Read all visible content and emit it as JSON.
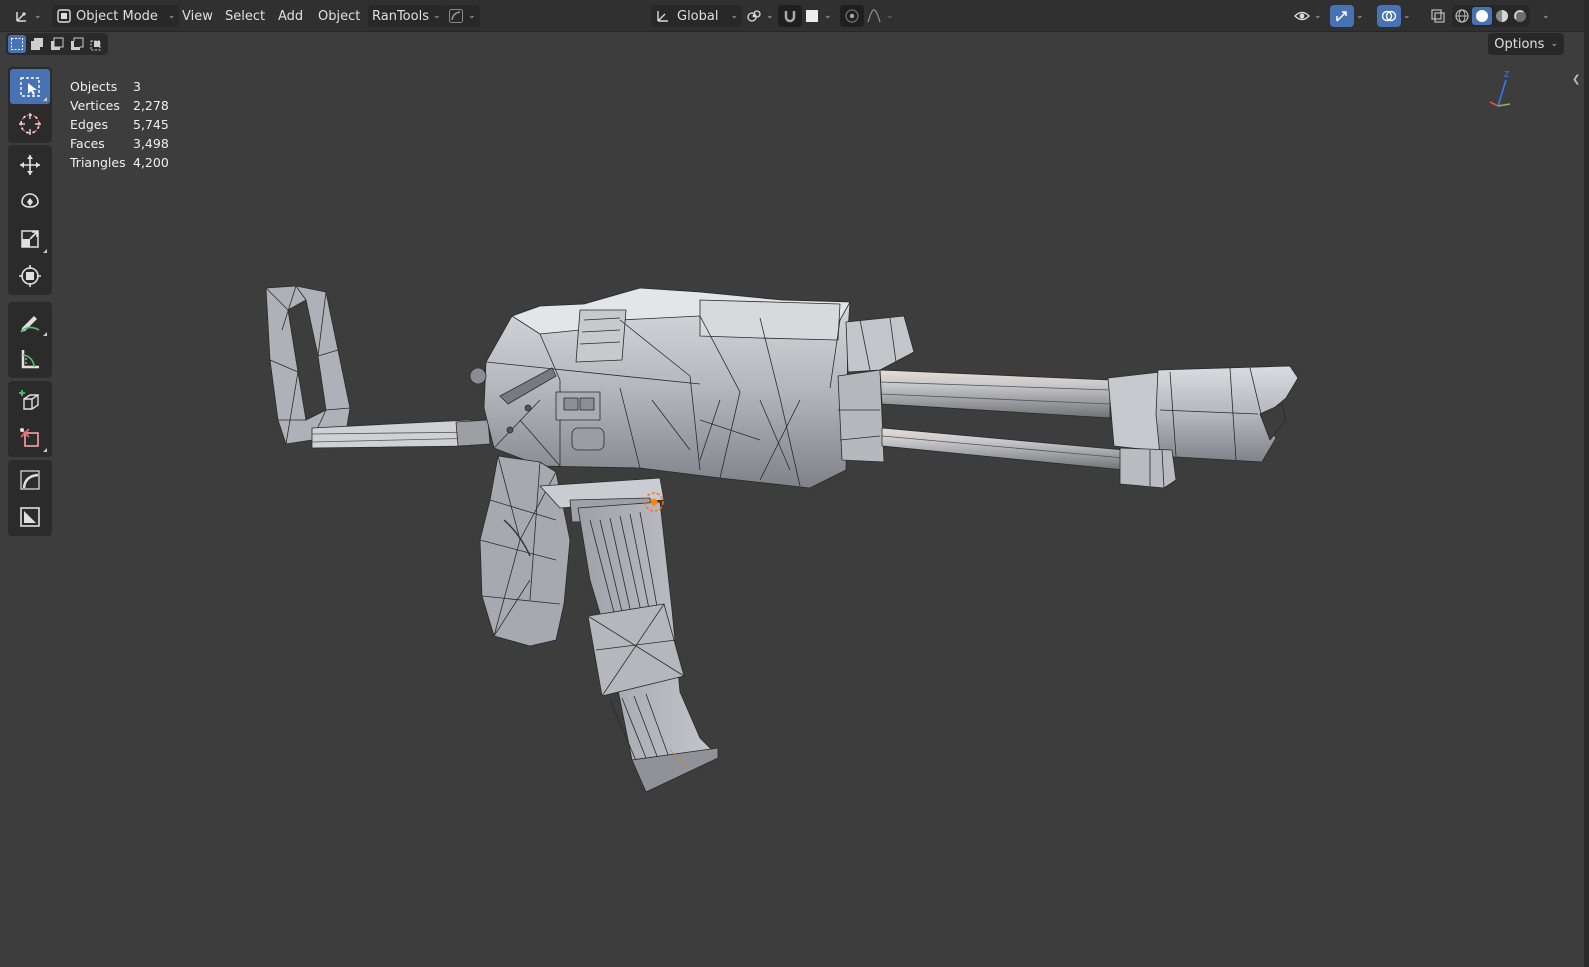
{
  "header": {
    "editor_type_icon": "transform-axis-icon",
    "mode": {
      "label": "Object Mode",
      "icon": "object-mode-icon"
    },
    "menus": [
      "View",
      "Select",
      "Add",
      "Object",
      "RanTools"
    ],
    "orientation": {
      "label": "Global",
      "icon": "orientation-axes-icon"
    },
    "pivot_icon": "pivot-point-icon",
    "snap_icon": "snap-magnet-icon",
    "proportional_icon": "proportional-editing-icon",
    "falloff_icon": "falloff-curve-icon",
    "visibility_icon": "eye-visibility-icon",
    "gizmo_icon": "gizmo-arrow-icon",
    "overlay_icon": "overlay-circles-icon",
    "xray_icon": "xray-toggle-icon",
    "shading_modes": [
      "wireframe",
      "solid",
      "material-preview",
      "rendered"
    ],
    "active_shading": "solid"
  },
  "toolbar_header": {
    "select_modes": [
      "set",
      "extend",
      "subtract",
      "difference",
      "intersect"
    ],
    "options_label": "Options"
  },
  "tools": [
    {
      "name": "select-box",
      "active": true
    },
    {
      "name": "cursor",
      "active": false
    },
    {
      "name": "move",
      "active": false
    },
    {
      "name": "rotate",
      "active": false
    },
    {
      "name": "scale",
      "active": false
    },
    {
      "name": "transform",
      "active": false
    },
    {
      "name": "annotate",
      "active": false
    },
    {
      "name": "measure",
      "active": false
    },
    {
      "name": "add-cube",
      "active": false
    },
    {
      "name": "edit-tool",
      "active": false
    },
    {
      "name": "curve-tool",
      "active": false
    },
    {
      "name": "image-tool",
      "active": false
    }
  ],
  "stats": {
    "objects_label": "Objects",
    "objects_value": "3",
    "vertices_label": "Vertices",
    "vertices_value": "2,278",
    "edges_label": "Edges",
    "edges_value": "5,745",
    "faces_label": "Faces",
    "faces_value": "3,498",
    "triangles_label": "Triangles",
    "triangles_value": "4,200"
  },
  "gizmo": {
    "axis_label": "Z"
  },
  "colors": {
    "accent": "#4772b3",
    "viewport_bg": "#3d3d3d",
    "header_bg": "#303030",
    "mesh_base": "#b8bcc2",
    "origin": "#ff8800"
  }
}
